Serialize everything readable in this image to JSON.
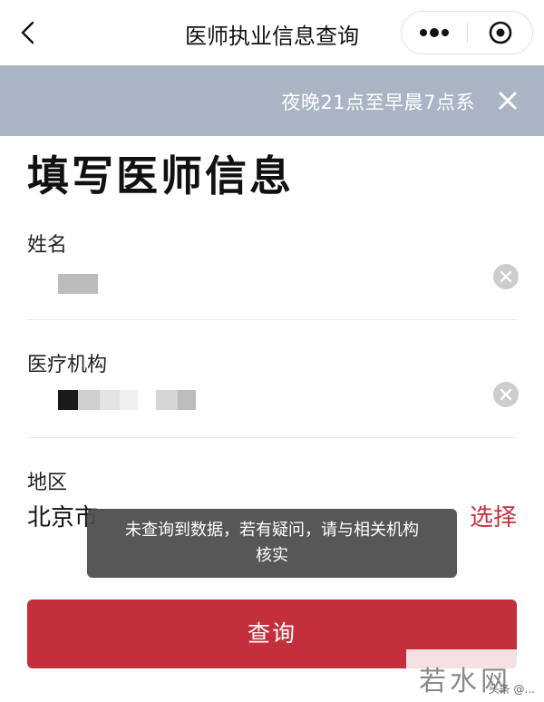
{
  "navbar": {
    "title": "医师执业信息查询",
    "back_icon": "chevron-left-icon",
    "more_icon": "more-dots-icon",
    "target_icon": "target-icon"
  },
  "banner": {
    "text": "夜晚21点至早晨7点系",
    "background": "#a9b5c4",
    "close_icon": "close-icon"
  },
  "form": {
    "heading": "填写医师信息",
    "name": {
      "label": "姓名",
      "value_masked": true
    },
    "institution": {
      "label": "医疗机构",
      "value_masked": true
    },
    "region": {
      "label": "地区",
      "value": "北京市",
      "action": "选择"
    }
  },
  "toast": {
    "line1": "未查询到数据，若有疑问，请与相关机构",
    "line2": "核实"
  },
  "submit": {
    "label": "查询",
    "color": "#c3303c"
  },
  "watermark": {
    "text": "若水网",
    "sub": "头条 @..."
  }
}
